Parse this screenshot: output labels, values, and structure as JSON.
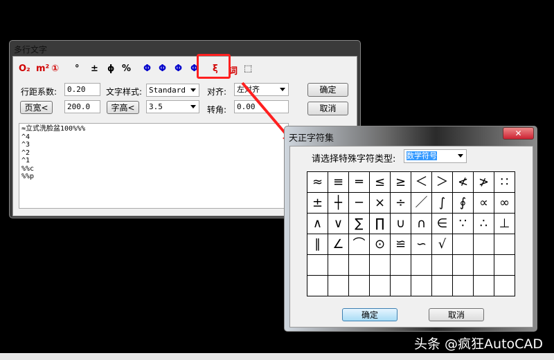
{
  "main_dialog": {
    "title": "多行文字",
    "toolbar": [
      {
        "icon": "o2-subscript-icon",
        "text": "O₂",
        "color": "#d00000"
      },
      {
        "icon": "m2-superscript-icon",
        "text": "m²",
        "color": "#d00000"
      },
      {
        "icon": "circled-number-icon",
        "text": "①",
        "color": "#d00000"
      },
      {
        "icon": "degree-icon",
        "text": "°",
        "color": "#000000"
      },
      {
        "icon": "plus-minus-icon",
        "text": "±",
        "color": "#000000"
      },
      {
        "icon": "diameter-icon",
        "text": "ϕ",
        "color": "#000000"
      },
      {
        "icon": "percent-icon",
        "text": "%",
        "color": "#000000"
      },
      {
        "icon": "steel-grade1-icon",
        "text": "Φ",
        "color": "#0000cc"
      },
      {
        "icon": "steel-grade2-icon",
        "text": "Φ",
        "color": "#0000cc"
      },
      {
        "icon": "steel-grade3-icon",
        "text": "Φ",
        "color": "#0000cc"
      },
      {
        "icon": "steel-grade4-icon",
        "text": "Φ",
        "color": "#0000cc"
      },
      {
        "icon": "special-char-icon",
        "text": "ξ",
        "color": "#d00000"
      },
      {
        "icon": "word-icon",
        "text": "词",
        "color": "#d00000"
      },
      {
        "icon": "pick-icon",
        "text": "⬚",
        "color": "#000000"
      }
    ],
    "line_spacing_label": "行距系数:",
    "line_spacing_value": "0.20",
    "text_style_label": "文字样式:",
    "text_style_value": "Standard",
    "align_label": "对齐:",
    "align_value": "左对齐",
    "ok": "确定",
    "cancel": "取消",
    "page_width_button": "页宽<",
    "page_width_value": "200.0",
    "text_height_button": "字高<",
    "text_height_value": "3.5",
    "rotation_label": "转角:",
    "rotation_value": "0.00",
    "content_lines": [
      "≈立式洗脸盆100%%%",
      "^4",
      "^3",
      "^2",
      "^1",
      "%%c",
      "%%p"
    ]
  },
  "char_dialog": {
    "title": "天正字符集",
    "prompt": "请选择特殊字符类型:",
    "type_value": "数学符号",
    "symbols": [
      "≈",
      "≡",
      "═",
      "≤",
      "≥",
      "＜",
      "＞",
      "≮",
      "≯",
      "∷",
      "±",
      "┼",
      "─",
      "×",
      "÷",
      "／",
      "∫",
      "∮",
      "∝",
      "∞",
      "∧",
      "∨",
      "∑",
      "∏",
      "∪",
      "∩",
      "∈",
      "∵",
      "∴",
      "⊥",
      "∥",
      "∠",
      "⌒",
      "⊙",
      "≌",
      "∽",
      "√",
      "",
      "",
      "",
      "",
      "",
      "",
      "",
      "",
      "",
      "",
      "",
      "",
      "",
      "",
      "",
      "",
      "",
      "",
      "",
      "",
      "",
      "",
      ""
    ],
    "ok": "确定",
    "cancel": "取消"
  },
  "watermark": "头条 @疯狂AutoCAD",
  "colors": {
    "highlight": "#ff2020"
  }
}
